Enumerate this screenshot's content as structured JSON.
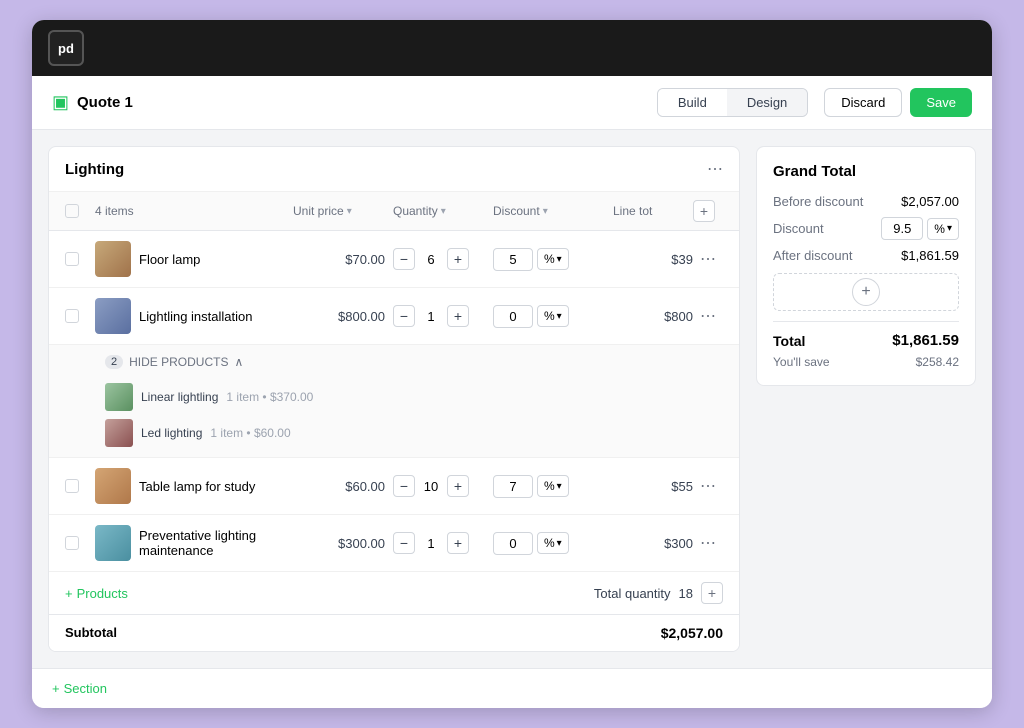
{
  "app": {
    "logo_text": "pd"
  },
  "header": {
    "quote_title": "Quote 1",
    "tabs": [
      {
        "id": "build",
        "label": "Build",
        "active": true
      },
      {
        "id": "design",
        "label": "Design",
        "active": false
      }
    ],
    "discard_label": "Discard",
    "save_label": "Save"
  },
  "section": {
    "title": "Lighting",
    "columns": {
      "item_label": "4 items",
      "unit_price": "Unit price",
      "quantity": "Quantity",
      "discount": "Discount",
      "line_total": "Line tot"
    },
    "products": [
      {
        "id": "floor-lamp",
        "name": "Floor lamp",
        "img_type": "lamp",
        "unit_price": "$70.00",
        "quantity": 6,
        "discount": 5,
        "discount_type": "%",
        "line_total": "$39"
      },
      {
        "id": "lighting-install",
        "name": "Lightling installation",
        "img_type": "install",
        "unit_price": "$800.00",
        "quantity": 1,
        "discount": 0,
        "discount_type": "%",
        "line_total": "$800",
        "has_subproducts": true,
        "subproducts_count": 2,
        "subproducts": [
          {
            "id": "linear-lightling",
            "name": "Linear lightling",
            "detail": "1 item • $370.00",
            "img_type": "linear"
          },
          {
            "id": "led-lighting",
            "name": "Led lighting",
            "detail": "1 item • $60.00",
            "img_type": "led"
          }
        ]
      },
      {
        "id": "table-lamp",
        "name": "Table lamp for study",
        "img_type": "table-lamp",
        "unit_price": "$60.00",
        "quantity": 10,
        "discount": 7,
        "discount_type": "%",
        "line_total": "$55"
      },
      {
        "id": "preventative",
        "name": "Preventative lighting maintenance",
        "img_type": "maintenance",
        "unit_price": "$300.00",
        "quantity": 1,
        "discount": 0,
        "discount_type": "%",
        "line_total": "$300"
      }
    ],
    "add_products_label": "Products",
    "total_quantity_label": "Total quantity",
    "total_quantity_value": "18",
    "subtotal_label": "Subtotal",
    "subtotal_value": "$2,057.00"
  },
  "grand_total": {
    "title": "Grand Total",
    "before_discount_label": "Before discount",
    "before_discount_value": "$2,057.00",
    "discount_label": "Discount",
    "discount_value": "9.5",
    "discount_type": "%",
    "after_discount_label": "After discount",
    "after_discount_value": "$1,861.59",
    "total_label": "Total",
    "total_value": "$1,861.59",
    "save_label": "You'll save",
    "save_value": "$258.42"
  },
  "bottom": {
    "add_section_label": "Section"
  }
}
